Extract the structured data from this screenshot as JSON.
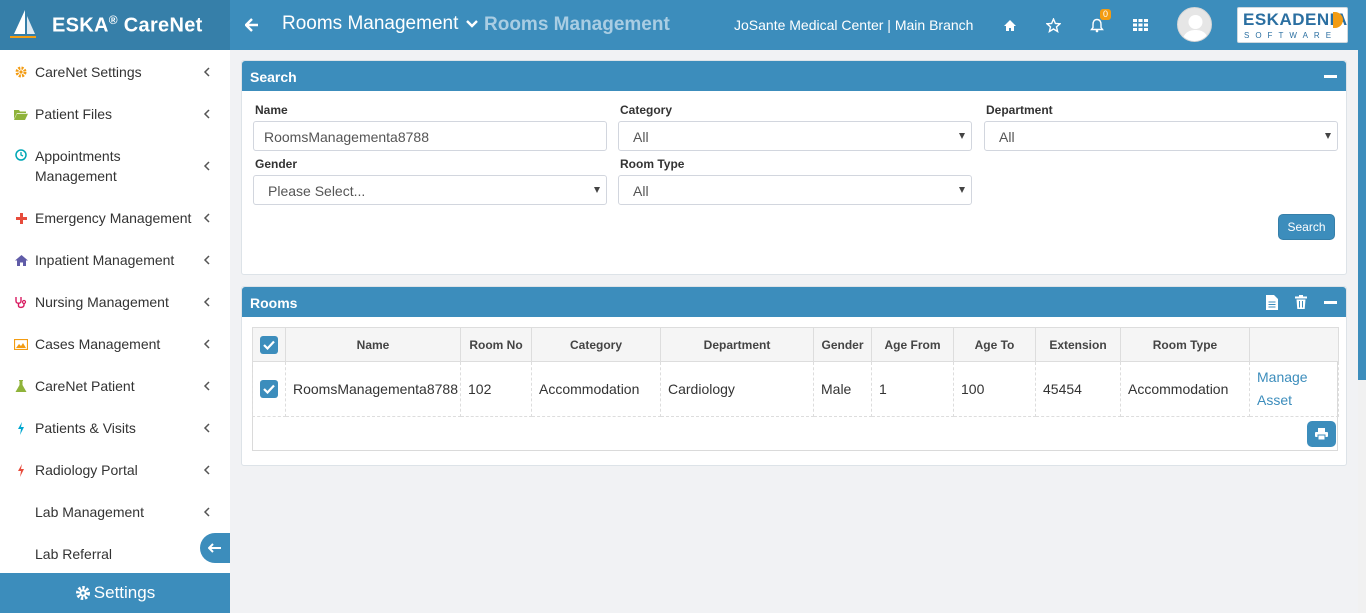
{
  "app": {
    "brand_main": "ESKA",
    "brand_reg": "®",
    "brand_sub": " CareNet",
    "module_title": "Rooms Management",
    "page_title": "Rooms Management",
    "organization": "JoSante Medical Center | Main Branch",
    "notification_count": "0",
    "vendor_logo_line1": "ESKADENIA",
    "vendor_logo_line2": "SOFTWARE"
  },
  "colors": {
    "primary": "#3c8dbc",
    "brand_dark": "#367fa9",
    "badge": "#f39c12"
  },
  "sidebar": {
    "items": [
      {
        "label": "CareNet Settings",
        "icon": "gear-icon",
        "icon_color": "#f39c12"
      },
      {
        "label": "Patient Files",
        "icon": "folder-open-icon",
        "icon_color": "#8fb33a"
      },
      {
        "label": "Appointments Management",
        "icon": "clock-icon",
        "icon_color": "#00a7b5"
      },
      {
        "label": "Emergency Management",
        "icon": "plus-icon",
        "icon_color": "#e74c3c"
      },
      {
        "label": "Inpatient Management",
        "icon": "home-icon",
        "icon_color": "#605ca8"
      },
      {
        "label": "Nursing Management",
        "icon": "stethoscope-icon",
        "icon_color": "#d81b60"
      },
      {
        "label": "Cases Management",
        "icon": "image-icon",
        "icon_color": "#f39c12"
      },
      {
        "label": "CareNet Patient",
        "icon": "flask-icon",
        "icon_color": "#8fb33a"
      },
      {
        "label": "Patients & Visits",
        "icon": "bolt-icon",
        "icon_color": "#00a7d0"
      },
      {
        "label": "Radiology Portal",
        "icon": "bolt-icon",
        "icon_color": "#e74c3c"
      },
      {
        "label": "Lab Management",
        "icon": "",
        "icon_color": ""
      },
      {
        "label": "Lab Referral",
        "icon": "",
        "icon_color": ""
      }
    ],
    "settings_label": "Settings"
  },
  "search_panel": {
    "title": "Search",
    "fields": {
      "name": {
        "label": "Name",
        "value": "RoomsManagementa8788"
      },
      "category": {
        "label": "Category",
        "value": "All"
      },
      "department": {
        "label": "Department",
        "value": "All"
      },
      "gender": {
        "label": "Gender",
        "value": "Please Select..."
      },
      "room_type": {
        "label": "Room Type",
        "value": "All"
      }
    },
    "search_button": "Search"
  },
  "rooms_panel": {
    "title": "Rooms",
    "columns": [
      "Name",
      "Room No",
      "Category",
      "Department",
      "Gender",
      "Age From",
      "Age To",
      "Extension",
      "Room Type",
      ""
    ],
    "rows": [
      {
        "checked": true,
        "name": "RoomsManagementa8788",
        "room_no": "102",
        "category": "Accommodation",
        "department": "Cardiology",
        "gender": "Male",
        "age_from": "1",
        "age_to": "100",
        "extension": "45454",
        "room_type": "Accommodation",
        "action_line1": "Manage",
        "action_line2": "Asset"
      }
    ]
  }
}
